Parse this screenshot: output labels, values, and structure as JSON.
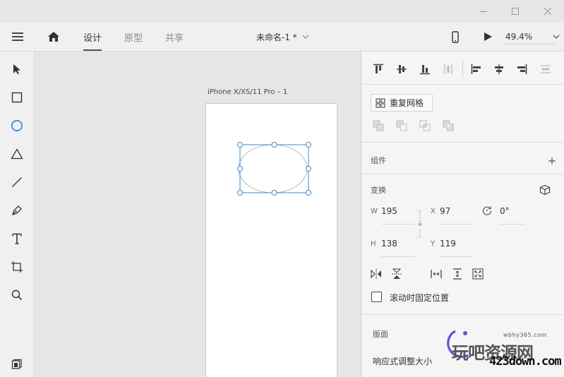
{
  "window": {
    "minimize_icon": "minimize-icon",
    "maximize_icon": "maximize-icon",
    "close_icon": "close-icon"
  },
  "toolbar": {
    "menu_icon": "hamburger-menu-icon",
    "home_icon": "home-icon",
    "tabs": [
      {
        "label": "设计",
        "active": true
      },
      {
        "label": "原型",
        "active": false
      },
      {
        "label": "共享",
        "active": false
      }
    ],
    "document_title": "未命名-1 *",
    "device_preview_icon": "mobile-device-icon",
    "play_icon": "play-icon",
    "zoom": "49.4%"
  },
  "tools": [
    {
      "name": "select-tool",
      "icon": "arrow-pointer-icon"
    },
    {
      "name": "rectangle-tool",
      "icon": "rectangle-icon"
    },
    {
      "name": "ellipse-tool",
      "icon": "ellipse-icon",
      "active": true
    },
    {
      "name": "polygon-tool",
      "icon": "triangle-icon"
    },
    {
      "name": "line-tool",
      "icon": "line-icon"
    },
    {
      "name": "pen-tool",
      "icon": "pen-icon"
    },
    {
      "name": "text-tool",
      "icon": "text-icon"
    },
    {
      "name": "artboard-tool",
      "icon": "artboard-icon"
    },
    {
      "name": "zoom-tool",
      "icon": "magnifier-icon"
    }
  ],
  "canvas": {
    "artboard_name": "iPhone X/XS/11 Pro – 1"
  },
  "panel": {
    "repeat_grid_label": "重复网格",
    "components_label": "组件",
    "transform_label": "变换",
    "w_label": "W",
    "w_value": "195",
    "x_label": "X",
    "x_value": "97",
    "rotation_value": "0°",
    "h_label": "H",
    "h_value": "138",
    "y_label": "Y",
    "y_value": "119",
    "fixed_position_label": "滚动时固定位置",
    "layout_label": "版面",
    "responsive_resize_label": "响应式调整大小"
  },
  "watermark": {
    "url_small": "wbhy365.com",
    "site_name": "玩吧资源网",
    "url_big": "423down.com"
  },
  "colors": {
    "accent": "#2680eb",
    "selection": "#3e8acc"
  }
}
